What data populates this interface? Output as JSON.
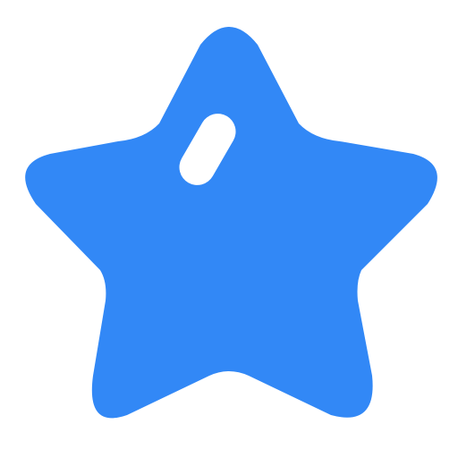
{
  "icon": {
    "name": "star-icon",
    "fill_color": "#3288F6",
    "highlight_color": "#FFFFFF",
    "background_color": "#FFFFFF"
  }
}
